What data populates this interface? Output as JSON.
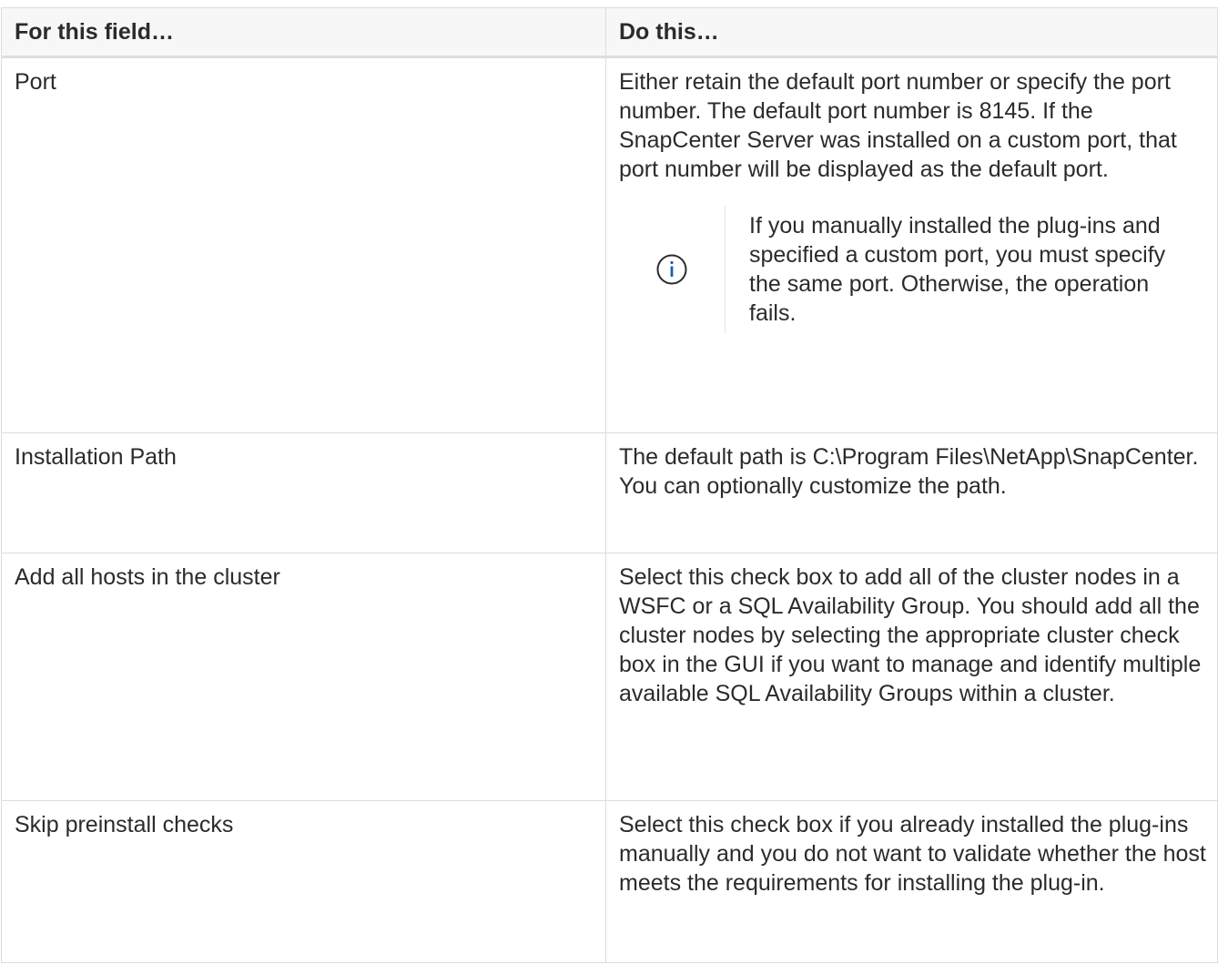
{
  "table": {
    "headers": {
      "field": "For this field…",
      "action": "Do this…"
    },
    "rows": [
      {
        "field": "Port",
        "action": "Either retain the default port number or specify the port number. The default port number is 8145. If the SnapCenter Server was installed on a custom port, that port number will be displayed as the default port.",
        "note": "If you manually installed the plug-ins and specified a custom port, you must specify the same port. Otherwise, the operation fails."
      },
      {
        "field": "Installation Path",
        "action": "The default path is C:\\Program Files\\NetApp\\SnapCenter. You can optionally customize the path."
      },
      {
        "field": "Add all hosts in the cluster",
        "action": "Select this check box to add all of the cluster nodes in a WSFC or a SQL Availability Group. You should add all the cluster nodes by selecting the appropriate cluster check box in the GUI if you want to manage and identify multiple available SQL Availability Groups within a cluster."
      },
      {
        "field": "Skip preinstall checks",
        "action": "Select this check box if you already installed the plug-ins manually and you do not want to validate whether the host meets the requirements for installing the plug-in."
      }
    ]
  },
  "icons": {
    "note_icon": "info-icon"
  },
  "colors": {
    "info_icon": "#1f5da8",
    "border": "#dddddd",
    "header_bg": "#f7f7f8"
  }
}
